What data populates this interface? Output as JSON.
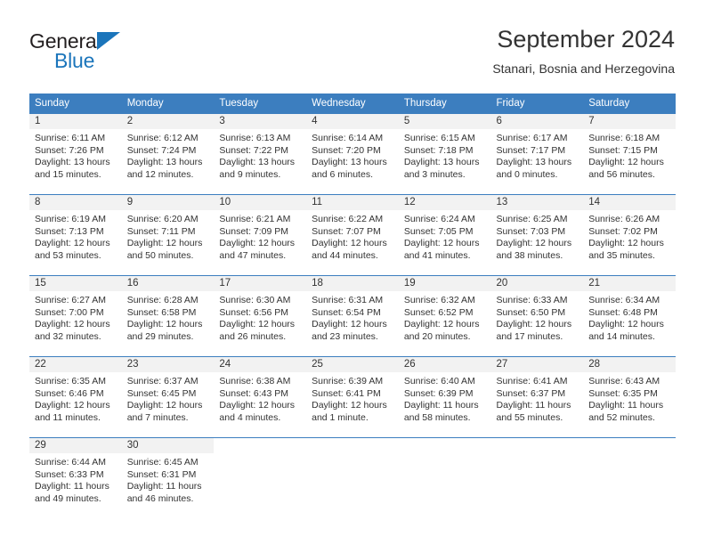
{
  "brand": {
    "name_part1": "General",
    "name_part2": "Blue",
    "logo_icon": "blue-triangle-icon"
  },
  "header": {
    "title": "September 2024",
    "subtitle": "Stanari, Bosnia and Herzegovina"
  },
  "colors": {
    "header_blue": "#3c7ebf",
    "brand_blue": "#1b75bb",
    "daynum_band": "#f2f2f2",
    "text": "#333333"
  },
  "weekdays": [
    "Sunday",
    "Monday",
    "Tuesday",
    "Wednesday",
    "Thursday",
    "Friday",
    "Saturday"
  ],
  "weeks": [
    [
      {
        "day": "1",
        "sunrise": "Sunrise: 6:11 AM",
        "sunset": "Sunset: 7:26 PM",
        "daylight_line1": "Daylight: 13 hours",
        "daylight_line2": "and 15 minutes."
      },
      {
        "day": "2",
        "sunrise": "Sunrise: 6:12 AM",
        "sunset": "Sunset: 7:24 PM",
        "daylight_line1": "Daylight: 13 hours",
        "daylight_line2": "and 12 minutes."
      },
      {
        "day": "3",
        "sunrise": "Sunrise: 6:13 AM",
        "sunset": "Sunset: 7:22 PM",
        "daylight_line1": "Daylight: 13 hours",
        "daylight_line2": "and 9 minutes."
      },
      {
        "day": "4",
        "sunrise": "Sunrise: 6:14 AM",
        "sunset": "Sunset: 7:20 PM",
        "daylight_line1": "Daylight: 13 hours",
        "daylight_line2": "and 6 minutes."
      },
      {
        "day": "5",
        "sunrise": "Sunrise: 6:15 AM",
        "sunset": "Sunset: 7:18 PM",
        "daylight_line1": "Daylight: 13 hours",
        "daylight_line2": "and 3 minutes."
      },
      {
        "day": "6",
        "sunrise": "Sunrise: 6:17 AM",
        "sunset": "Sunset: 7:17 PM",
        "daylight_line1": "Daylight: 13 hours",
        "daylight_line2": "and 0 minutes."
      },
      {
        "day": "7",
        "sunrise": "Sunrise: 6:18 AM",
        "sunset": "Sunset: 7:15 PM",
        "daylight_line1": "Daylight: 12 hours",
        "daylight_line2": "and 56 minutes."
      }
    ],
    [
      {
        "day": "8",
        "sunrise": "Sunrise: 6:19 AM",
        "sunset": "Sunset: 7:13 PM",
        "daylight_line1": "Daylight: 12 hours",
        "daylight_line2": "and 53 minutes."
      },
      {
        "day": "9",
        "sunrise": "Sunrise: 6:20 AM",
        "sunset": "Sunset: 7:11 PM",
        "daylight_line1": "Daylight: 12 hours",
        "daylight_line2": "and 50 minutes."
      },
      {
        "day": "10",
        "sunrise": "Sunrise: 6:21 AM",
        "sunset": "Sunset: 7:09 PM",
        "daylight_line1": "Daylight: 12 hours",
        "daylight_line2": "and 47 minutes."
      },
      {
        "day": "11",
        "sunrise": "Sunrise: 6:22 AM",
        "sunset": "Sunset: 7:07 PM",
        "daylight_line1": "Daylight: 12 hours",
        "daylight_line2": "and 44 minutes."
      },
      {
        "day": "12",
        "sunrise": "Sunrise: 6:24 AM",
        "sunset": "Sunset: 7:05 PM",
        "daylight_line1": "Daylight: 12 hours",
        "daylight_line2": "and 41 minutes."
      },
      {
        "day": "13",
        "sunrise": "Sunrise: 6:25 AM",
        "sunset": "Sunset: 7:03 PM",
        "daylight_line1": "Daylight: 12 hours",
        "daylight_line2": "and 38 minutes."
      },
      {
        "day": "14",
        "sunrise": "Sunrise: 6:26 AM",
        "sunset": "Sunset: 7:02 PM",
        "daylight_line1": "Daylight: 12 hours",
        "daylight_line2": "and 35 minutes."
      }
    ],
    [
      {
        "day": "15",
        "sunrise": "Sunrise: 6:27 AM",
        "sunset": "Sunset: 7:00 PM",
        "daylight_line1": "Daylight: 12 hours",
        "daylight_line2": "and 32 minutes."
      },
      {
        "day": "16",
        "sunrise": "Sunrise: 6:28 AM",
        "sunset": "Sunset: 6:58 PM",
        "daylight_line1": "Daylight: 12 hours",
        "daylight_line2": "and 29 minutes."
      },
      {
        "day": "17",
        "sunrise": "Sunrise: 6:30 AM",
        "sunset": "Sunset: 6:56 PM",
        "daylight_line1": "Daylight: 12 hours",
        "daylight_line2": "and 26 minutes."
      },
      {
        "day": "18",
        "sunrise": "Sunrise: 6:31 AM",
        "sunset": "Sunset: 6:54 PM",
        "daylight_line1": "Daylight: 12 hours",
        "daylight_line2": "and 23 minutes."
      },
      {
        "day": "19",
        "sunrise": "Sunrise: 6:32 AM",
        "sunset": "Sunset: 6:52 PM",
        "daylight_line1": "Daylight: 12 hours",
        "daylight_line2": "and 20 minutes."
      },
      {
        "day": "20",
        "sunrise": "Sunrise: 6:33 AM",
        "sunset": "Sunset: 6:50 PM",
        "daylight_line1": "Daylight: 12 hours",
        "daylight_line2": "and 17 minutes."
      },
      {
        "day": "21",
        "sunrise": "Sunrise: 6:34 AM",
        "sunset": "Sunset: 6:48 PM",
        "daylight_line1": "Daylight: 12 hours",
        "daylight_line2": "and 14 minutes."
      }
    ],
    [
      {
        "day": "22",
        "sunrise": "Sunrise: 6:35 AM",
        "sunset": "Sunset: 6:46 PM",
        "daylight_line1": "Daylight: 12 hours",
        "daylight_line2": "and 11 minutes."
      },
      {
        "day": "23",
        "sunrise": "Sunrise: 6:37 AM",
        "sunset": "Sunset: 6:45 PM",
        "daylight_line1": "Daylight: 12 hours",
        "daylight_line2": "and 7 minutes."
      },
      {
        "day": "24",
        "sunrise": "Sunrise: 6:38 AM",
        "sunset": "Sunset: 6:43 PM",
        "daylight_line1": "Daylight: 12 hours",
        "daylight_line2": "and 4 minutes."
      },
      {
        "day": "25",
        "sunrise": "Sunrise: 6:39 AM",
        "sunset": "Sunset: 6:41 PM",
        "daylight_line1": "Daylight: 12 hours",
        "daylight_line2": "and 1 minute."
      },
      {
        "day": "26",
        "sunrise": "Sunrise: 6:40 AM",
        "sunset": "Sunset: 6:39 PM",
        "daylight_line1": "Daylight: 11 hours",
        "daylight_line2": "and 58 minutes."
      },
      {
        "day": "27",
        "sunrise": "Sunrise: 6:41 AM",
        "sunset": "Sunset: 6:37 PM",
        "daylight_line1": "Daylight: 11 hours",
        "daylight_line2": "and 55 minutes."
      },
      {
        "day": "28",
        "sunrise": "Sunrise: 6:43 AM",
        "sunset": "Sunset: 6:35 PM",
        "daylight_line1": "Daylight: 11 hours",
        "daylight_line2": "and 52 minutes."
      }
    ],
    [
      {
        "day": "29",
        "sunrise": "Sunrise: 6:44 AM",
        "sunset": "Sunset: 6:33 PM",
        "daylight_line1": "Daylight: 11 hours",
        "daylight_line2": "and 49 minutes."
      },
      {
        "day": "30",
        "sunrise": "Sunrise: 6:45 AM",
        "sunset": "Sunset: 6:31 PM",
        "daylight_line1": "Daylight: 11 hours",
        "daylight_line2": "and 46 minutes."
      },
      {
        "day": "",
        "sunrise": "",
        "sunset": "",
        "daylight_line1": "",
        "daylight_line2": ""
      },
      {
        "day": "",
        "sunrise": "",
        "sunset": "",
        "daylight_line1": "",
        "daylight_line2": ""
      },
      {
        "day": "",
        "sunrise": "",
        "sunset": "",
        "daylight_line1": "",
        "daylight_line2": ""
      },
      {
        "day": "",
        "sunrise": "",
        "sunset": "",
        "daylight_line1": "",
        "daylight_line2": ""
      },
      {
        "day": "",
        "sunrise": "",
        "sunset": "",
        "daylight_line1": "",
        "daylight_line2": ""
      }
    ]
  ]
}
